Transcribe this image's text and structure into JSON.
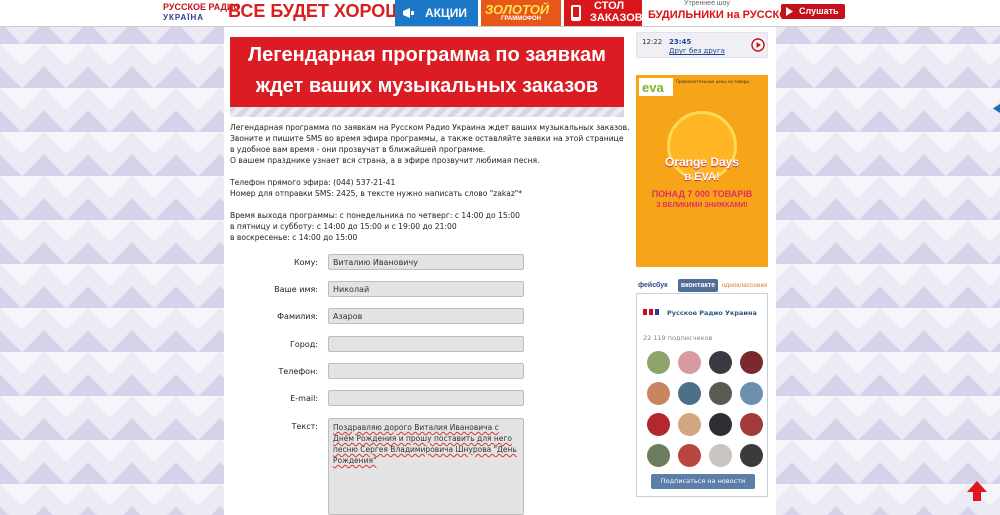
{
  "header": {
    "logo_line1": "РУССКОЕ РАДИО",
    "logo_line2": "УКРАЇНА",
    "slogan": "ВСЕ БУДЕТ ХОРОШО!",
    "nav_actions": "АКЦИИ",
    "nav_gold_1": "ЗОЛОТОЙ",
    "nav_gold_2": "ГРАММОФОН",
    "nav_stol_1": "СТОЛ",
    "nav_stol_2": "ЗАКАЗОВ",
    "show_caption": "Утреннее шоу",
    "show_title": "БУДИЛЬНИКИ на РУССКОМ",
    "listen_label": "Слушать"
  },
  "banner": {
    "line1": "Легендарная программа по заявкам",
    "line2": "ждет ваших музыкальных заказов"
  },
  "description": [
    "Легендарная программа по заявкам на Русском Радио Украина ждет ваших музыкальных заказов.",
    "Звоните и пишите SMS во время эфира программы, а также оставляйте заявки на этой странице",
    "в удобное вам время - они прозвучат в ближайшей программе.",
    "О вашем празднике узнает вся страна, а в эфире прозвучит любимая песня.",
    "",
    "Телефон прямого эфира: (044) 537-21-41",
    "Номер для отправки SMS: 2425, в тексте нужно написать слово \"zakaz\"*",
    "",
    "Время выхода программы: с понедельника по четверг: с 14:00 до 15:00",
    "в пятницу и субботу: с 14:00 до 15:00 и с 19:00 до 21:00",
    "в воскресенье: с 14:00 до 15:00"
  ],
  "form": {
    "to_label": "Кому:",
    "to_value": "Виталию Ивановичу",
    "name_label": "Ваше имя:",
    "name_value": "Николай",
    "surname_label": "Фамилия:",
    "surname_value": "Азаров",
    "city_label": "Город:",
    "city_value": "",
    "phone_label": "Телефон:",
    "phone_value": "",
    "email_label": "E-mail:",
    "email_value": "",
    "text_label": "Текст:",
    "text_value": "Поздравляю дорого Виталия Ивановича с Днём Рождения и прошу поставить для него песню Сергея Владимировича Шнурова \"День Рождения\""
  },
  "player": {
    "current_time": "12:22",
    "song_time": "23:45",
    "song_name": "Друг без друга"
  },
  "ad": {
    "small_text": "Привлекательные цены на товары",
    "title_1": "Orange Days",
    "title_2": "в EVA!",
    "line_3": "ПОНАД 7 000 ТОВАРІВ",
    "line_4": "З ВЕЛИКИМИ ЗНИЖКАМИ!"
  },
  "social": {
    "tab_facebook": "фейсбук",
    "tab_vk": "вконтакте",
    "tab_ok": "одноклассники",
    "group_name": "Русское Радио Украина",
    "subscribers": "22 119 подписчиков",
    "subscribe_button": "Подписаться на новости"
  },
  "colors": {
    "brand_red": "#dc1c23",
    "vk_blue": "#5b7fa6",
    "actions_blue": "#1b78c8",
    "gold_orange": "#e8571a"
  }
}
